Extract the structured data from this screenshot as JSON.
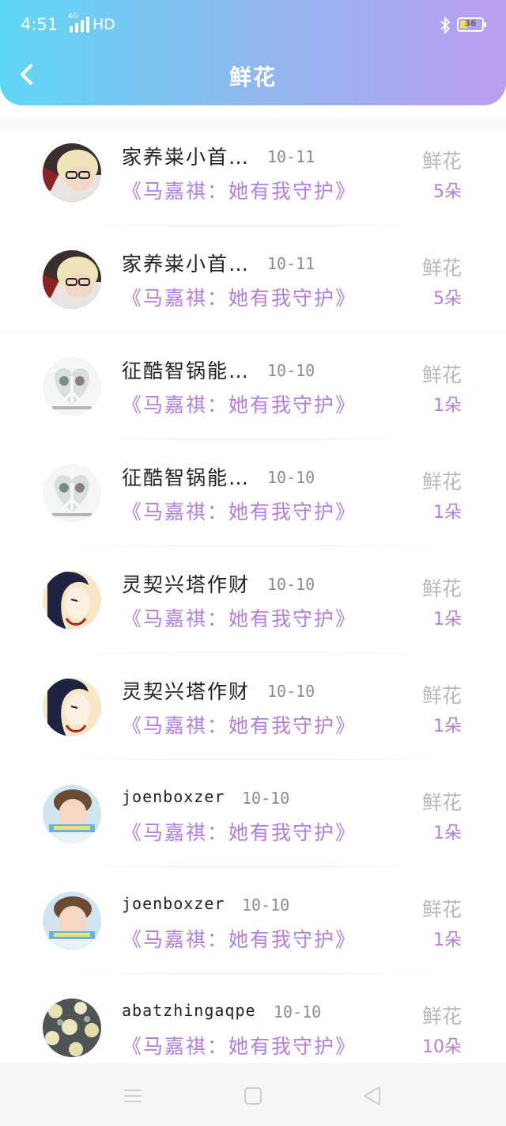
{
  "status_bar": {
    "time": "4:51",
    "network_type": "4G",
    "hd": "HD",
    "battery_level": "36",
    "battery_fraction": 0.36,
    "battery_color": "#f1e04a"
  },
  "header": {
    "title": "鲜花",
    "back_icon": "back-arrow-icon",
    "gradient_colors": [
      "#5ed7f6",
      "#bb9df0"
    ]
  },
  "accent_color": "#b37ee0",
  "records": [
    {
      "user": "家养粜小首…",
      "date": "10-11",
      "book": "《马嘉祺：她有我守护》",
      "label": "鲜花",
      "count": "5朵",
      "avatar": "avatar-blonde-glasses"
    },
    {
      "user": "家养粜小首…",
      "date": "10-11",
      "book": "《马嘉祺：她有我守护》",
      "label": "鲜花",
      "count": "5朵",
      "avatar": "avatar-blonde-glasses"
    },
    {
      "user": "征酷智锅能…",
      "date": "10-10",
      "book": "《马嘉祺：她有我守护》",
      "label": "鲜花",
      "count": "1朵",
      "avatar": "avatar-heart-snow"
    },
    {
      "user": "征酷智锅能…",
      "date": "10-10",
      "book": "《马嘉祺：她有我守护》",
      "label": "鲜花",
      "count": "1朵",
      "avatar": "avatar-heart-snow"
    },
    {
      "user": "灵契兴塔作财",
      "date": "10-10",
      "book": "《马嘉祺：她有我守护》",
      "label": "鲜花",
      "count": "1朵",
      "avatar": "avatar-anime-girl"
    },
    {
      "user": "灵契兴塔作财",
      "date": "10-10",
      "book": "《马嘉祺：她有我守护》",
      "label": "鲜花",
      "count": "1朵",
      "avatar": "avatar-anime-girl"
    },
    {
      "user": "joenboxzer",
      "date": "10-10",
      "book": "《马嘉祺：她有我守护》",
      "label": "鲜花",
      "count": "1朵",
      "avatar": "avatar-boy-photo"
    },
    {
      "user": "joenboxzer",
      "date": "10-10",
      "book": "《马嘉祺：她有我守护》",
      "label": "鲜花",
      "count": "1朵",
      "avatar": "avatar-boy-photo"
    },
    {
      "user": "abatzhingaqpe",
      "date": "10-10",
      "book": "《马嘉祺：她有我守护》",
      "label": "鲜花",
      "count": "10朵",
      "avatar": "avatar-floral-pattern"
    }
  ],
  "nav_bar": {
    "menu_icon": "menu-icon",
    "home_icon": "home-square-icon",
    "back_icon": "back-triangle-icon"
  }
}
